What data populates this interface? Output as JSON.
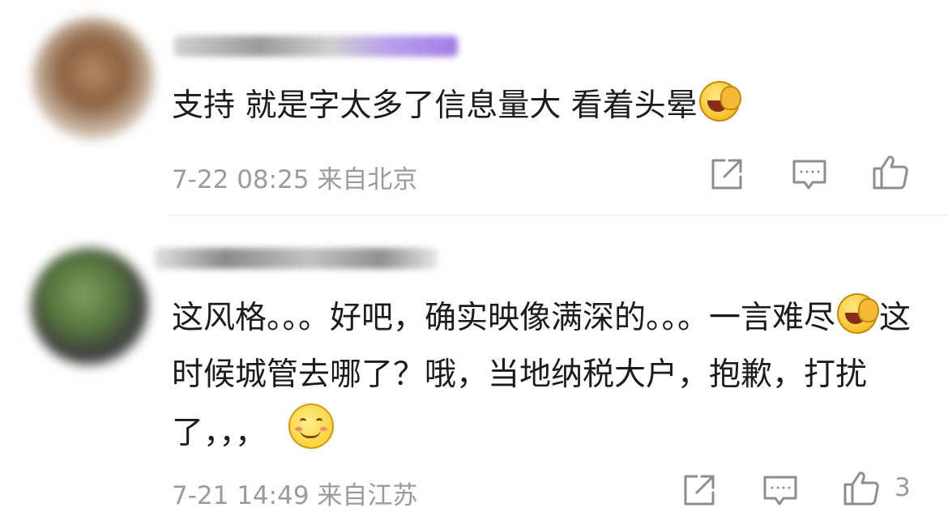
{
  "comments": [
    {
      "text_parts": [
        "支持 就是字太多了信息量大 看着头晕"
      ],
      "emojis": [
        "laugh-cry-emoji"
      ],
      "timestamp": "7-22 08:25",
      "location": "来自北京",
      "likes": ""
    },
    {
      "text_parts": [
        "这风格。。。好吧，确实映像满深的。。。一言难尽",
        "这时候城管去哪了？哦，当地纳税大户，抱歉，打扰了，，，"
      ],
      "emojis": [
        "laugh-cry-emoji",
        "smile-emoji"
      ],
      "timestamp": "7-21 14:49",
      "location": "来自江苏",
      "likes": "3"
    }
  ],
  "icons": {
    "share": "share-icon",
    "reply": "comment-icon",
    "like": "thumbs-up-icon"
  },
  "colors": {
    "text": "#1c1c1c",
    "meta": "#9b9b9b",
    "divider": "#ececec",
    "emoji_yellow": "#f8c22b"
  }
}
